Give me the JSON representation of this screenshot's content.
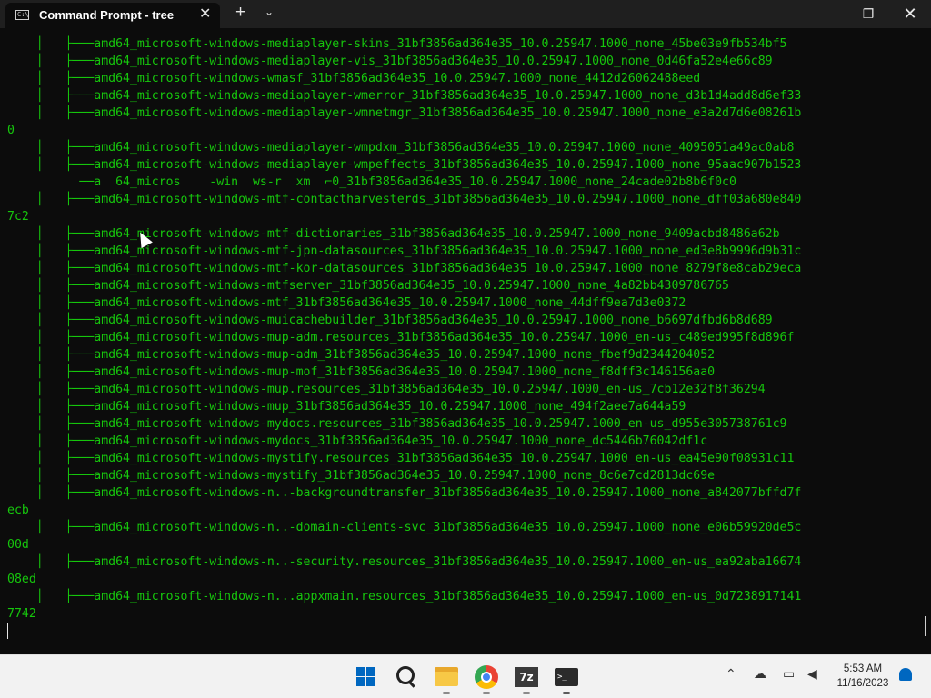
{
  "window": {
    "tab_title": "Command Prompt - tree",
    "tab_icon_text": "C:\\",
    "close_tab": "✕",
    "new_tab": "+",
    "dropdown": "⌄",
    "minimize": "—",
    "maximize": "❐",
    "close": "✕"
  },
  "terminal": {
    "lines": [
      "    │   ├───amd64_microsoft-windows-mediaplayer-skins_31bf3856ad364e35_10.0.25947.1000_none_45be03e9fb534bf5",
      "    │   ├───amd64_microsoft-windows-mediaplayer-vis_31bf3856ad364e35_10.0.25947.1000_none_0d46fa52e4e66c89",
      "    │   ├───amd64_microsoft-windows-wmasf_31bf3856ad364e35_10.0.25947.1000_none_4412d26062488eed",
      "    │   ├───amd64_microsoft-windows-mediaplayer-wmerror_31bf3856ad364e35_10.0.25947.1000_none_d3b1d4add8d6ef33",
      "    │   ├───amd64_microsoft-windows-mediaplayer-wmnetmgr_31bf3856ad364e35_10.0.25947.1000_none_e3a2d7d6e08261b",
      "0",
      "    │   ├───amd64_microsoft-windows-mediaplayer-wmpdxm_31bf3856ad364e35_10.0.25947.1000_none_4095051a49ac0ab8",
      "    │   ├───amd64_microsoft-windows-mediaplayer-wmpeffects_31bf3856ad364e35_10.0.25947.1000_none_95aac907b1523",
      "          ──a  64_micros    -win  ws-r  xm  ⌐0_31bf3856ad364e35_10.0.25947.1000_none_24cade02b8b6f0c0",
      "    │   ├───amd64_microsoft-windows-mtf-contactharvesterds_31bf3856ad364e35_10.0.25947.1000_none_dff03a680e840",
      "7c2",
      "    │   ├───amd64_microsoft-windows-mtf-dictionaries_31bf3856ad364e35_10.0.25947.1000_none_9409acbd8486a62b",
      "    │   ├───amd64_microsoft-windows-mtf-jpn-datasources_31bf3856ad364e35_10.0.25947.1000_none_ed3e8b9996d9b31c",
      "    │   ├───amd64_microsoft-windows-mtf-kor-datasources_31bf3856ad364e35_10.0.25947.1000_none_8279f8e8cab29eca",
      "    │   ├───amd64_microsoft-windows-mtfserver_31bf3856ad364e35_10.0.25947.1000_none_4a82bb4309786765",
      "    │   ├───amd64_microsoft-windows-mtf_31bf3856ad364e35_10.0.25947.1000_none_44dff9ea7d3e0372",
      "    │   ├───amd64_microsoft-windows-muicachebuilder_31bf3856ad364e35_10.0.25947.1000_none_b6697dfbd6b8d689",
      "    │   ├───amd64_microsoft-windows-mup-adm.resources_31bf3856ad364e35_10.0.25947.1000_en-us_c489ed995f8d896f",
      "    │   ├───amd64_microsoft-windows-mup-adm_31bf3856ad364e35_10.0.25947.1000_none_fbef9d2344204052",
      "    │   ├───amd64_microsoft-windows-mup-mof_31bf3856ad364e35_10.0.25947.1000_none_f8dff3c146156aa0",
      "    │   ├───amd64_microsoft-windows-mup.resources_31bf3856ad364e35_10.0.25947.1000_en-us_7cb12e32f8f36294",
      "    │   ├───amd64_microsoft-windows-mup_31bf3856ad364e35_10.0.25947.1000_none_494f2aee7a644a59",
      "    │   ├───amd64_microsoft-windows-mydocs.resources_31bf3856ad364e35_10.0.25947.1000_en-us_d955e305738761c9",
      "    │   ├───amd64_microsoft-windows-mydocs_31bf3856ad364e35_10.0.25947.1000_none_dc5446b76042df1c",
      "    │   ├───amd64_microsoft-windows-mystify.resources_31bf3856ad364e35_10.0.25947.1000_en-us_ea45e90f08931c11",
      "    │   ├───amd64_microsoft-windows-mystify_31bf3856ad364e35_10.0.25947.1000_none_8c6e7cd2813dc69e",
      "    │   ├───amd64_microsoft-windows-n..-backgroundtransfer_31bf3856ad364e35_10.0.25947.1000_none_a842077bffd7f",
      "ecb",
      "    │   ├───amd64_microsoft-windows-n..-domain-clients-svc_31bf3856ad364e35_10.0.25947.1000_none_e06b59920de5c",
      "00d",
      "    │   ├───amd64_microsoft-windows-n..-security.resources_31bf3856ad364e35_10.0.25947.1000_en-us_ea92aba16674",
      "08ed",
      "    │   ├───amd64_microsoft-windows-n...appxmain.resources_31bf3856ad364e35_10.0.25947.1000_en-us_0d7238917141",
      "7742"
    ]
  },
  "taskbar": {
    "start_icon": "start-icon",
    "apps": [
      "search-icon",
      "file-explorer-icon",
      "chrome-icon",
      "7zip-icon",
      "terminal-icon"
    ],
    "sevenzip_label": "7z",
    "terminal_label": ">_",
    "tray_chevron": "⌃",
    "tray_cloud": "☁",
    "tray_network": "▭",
    "tray_volume": "◀",
    "time": "5:53 AM",
    "date": "11/16/2023"
  },
  "colors": {
    "terminal_bg": "#0c0c0c",
    "terminal_text": "#16c60c",
    "taskbar_bg": "#f2f2f2",
    "accent": "#0067c0"
  }
}
